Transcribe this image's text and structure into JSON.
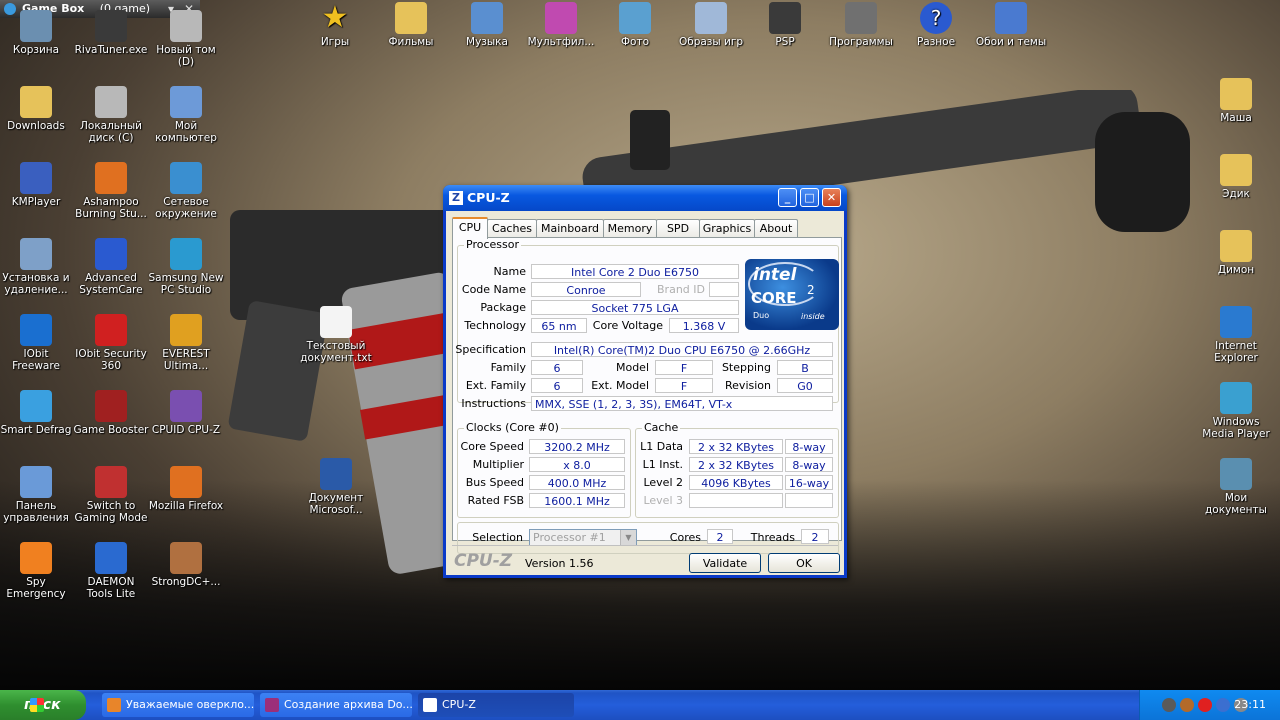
{
  "gamebox": {
    "title": "Game Box",
    "count": "(0 game)"
  },
  "desktop": {
    "icons_left": [
      {
        "label": "Корзина",
        "icon": "recycle-bin-icon"
      },
      {
        "label": "RivaTuner.exe",
        "icon": "rivatuner-icon"
      },
      {
        "label": "Новый том (D)",
        "icon": "drive-icon"
      },
      {
        "label": "Downloads",
        "icon": "folder-icon"
      },
      {
        "label": "Локальный диск (C)",
        "icon": "drive-icon"
      },
      {
        "label": "Мой компьютер",
        "icon": "computer-icon"
      },
      {
        "label": "KMPlayer",
        "icon": "kmplayer-icon"
      },
      {
        "label": "Ashampoo Burning Stu...",
        "icon": "ashampoo-icon"
      },
      {
        "label": "Сетевое окружение",
        "icon": "network-icon"
      },
      {
        "label": "Установка и удаление...",
        "icon": "installer-icon"
      },
      {
        "label": "Advanced SystemCare",
        "icon": "systemcare-icon"
      },
      {
        "label": "Samsung New PC Studio",
        "icon": "samsung-icon"
      },
      {
        "label": "IObit Freeware",
        "icon": "iobit-icon"
      },
      {
        "label": "IObit Security 360",
        "icon": "iobit-security-icon"
      },
      {
        "label": "EVEREST Ultima...",
        "icon": "everest-icon"
      },
      {
        "label": "Smart Defrag",
        "icon": "defrag-icon"
      },
      {
        "label": "Game Booster",
        "icon": "gamebooster-icon"
      },
      {
        "label": "CPUID CPU-Z",
        "icon": "cpuz-icon"
      },
      {
        "label": "Панель управления",
        "icon": "control-panel-icon"
      },
      {
        "label": "Switch to Gaming Mode",
        "icon": "gaming-mode-icon"
      },
      {
        "label": "Mozilla Firefox",
        "icon": "firefox-icon"
      },
      {
        "label": "Spy Emergency",
        "icon": "spy-icon"
      },
      {
        "label": "DAEMON Tools Lite",
        "icon": "daemon-icon"
      },
      {
        "label": "StrongDC+...",
        "icon": "strongdc-icon"
      }
    ],
    "icons_top": [
      {
        "label": "Игры",
        "icon": "star-icon"
      },
      {
        "label": "Фильмы",
        "icon": "folder-icon"
      },
      {
        "label": "Музыка",
        "icon": "music-icon"
      },
      {
        "label": "Мультфил...",
        "icon": "cartoon-icon"
      },
      {
        "label": "Фото",
        "icon": "photo-icon"
      },
      {
        "label": "Образы игр",
        "icon": "disc-icon"
      },
      {
        "label": "PSP",
        "icon": "psp-icon"
      },
      {
        "label": "Программы",
        "icon": "programs-icon"
      },
      {
        "label": "Разное",
        "icon": "help-icon"
      },
      {
        "label": "Обои и темы",
        "icon": "monitor-icon"
      }
    ],
    "icons_mid": [
      {
        "label": "Текстовый документ.txt",
        "icon": "text-file-icon"
      },
      {
        "label": "Документ Microsof...",
        "icon": "word-doc-icon"
      }
    ],
    "icons_right": [
      {
        "label": "Маша",
        "icon": "folder-icon"
      },
      {
        "label": "Эдик",
        "icon": "folder-icon"
      },
      {
        "label": "Димон",
        "icon": "folder-icon"
      },
      {
        "label": "Internet Explorer",
        "icon": "ie-icon"
      },
      {
        "label": "Windows Media Player",
        "icon": "wmp-icon"
      },
      {
        "label": "Мои документы",
        "icon": "my-documents-icon"
      }
    ]
  },
  "cpuz": {
    "title": "CPU-Z",
    "tabs": [
      "CPU",
      "Caches",
      "Mainboard",
      "Memory",
      "SPD",
      "Graphics",
      "About"
    ],
    "processor": {
      "group": "Processor",
      "name_label": "Name",
      "name": "Intel Core 2 Duo E6750",
      "codename_label": "Code Name",
      "codename": "Conroe",
      "brandid_label": "Brand ID",
      "package_label": "Package",
      "package": "Socket 775 LGA",
      "technology_label": "Technology",
      "technology": "65 nm",
      "voltage_label": "Core Voltage",
      "voltage": "1.368 V",
      "spec_label": "Specification",
      "spec": "Intel(R) Core(TM)2 Duo CPU     E6750  @ 2.66GHz",
      "family_label": "Family",
      "family": "6",
      "model_label": "Model",
      "model": "F",
      "stepping_label": "Stepping",
      "stepping": "B",
      "extfamily_label": "Ext. Family",
      "extfamily": "6",
      "extmodel_label": "Ext. Model",
      "extmodel": "F",
      "revision_label": "Revision",
      "revision": "G0",
      "instructions_label": "Instructions",
      "instructions": "MMX, SSE (1, 2, 3, 3S), EM64T, VT-x"
    },
    "intel_logo": {
      "brand": "intel",
      "line": "CORE",
      "gen": "2",
      "sub": "Duo",
      "inside": "inside"
    },
    "clocks": {
      "group": "Clocks (Core #0)",
      "corespeed_label": "Core Speed",
      "corespeed": "3200.2 MHz",
      "multiplier_label": "Multiplier",
      "multiplier": "x 8.0",
      "busspeed_label": "Bus Speed",
      "busspeed": "400.0 MHz",
      "fsb_label": "Rated FSB",
      "fsb": "1600.1 MHz"
    },
    "cache": {
      "group": "Cache",
      "l1d_label": "L1 Data",
      "l1d": "2 x 32 KBytes",
      "l1d_way": "8-way",
      "l1i_label": "L1 Inst.",
      "l1i": "2 x 32 KBytes",
      "l1i_way": "8-way",
      "l2_label": "Level 2",
      "l2": "4096 KBytes",
      "l2_way": "16-way",
      "l3_label": "Level 3"
    },
    "selection_label": "Selection",
    "selection": "Processor #1",
    "cores_label": "Cores",
    "cores": "2",
    "threads_label": "Threads",
    "threads": "2",
    "footer_logo": "CPU-Z",
    "version": "Version 1.56",
    "validate": "Validate",
    "ok": "OK"
  },
  "taskbar": {
    "start": "пуск",
    "tasks": [
      "Уважаемые оверклo...",
      "Создание архива Do...",
      "CPU-Z"
    ],
    "clock": "23:11"
  },
  "colors": {
    "xp_blue": "#0548c8",
    "start_green": "#2f8f2f",
    "value_text": "#1020a0"
  }
}
